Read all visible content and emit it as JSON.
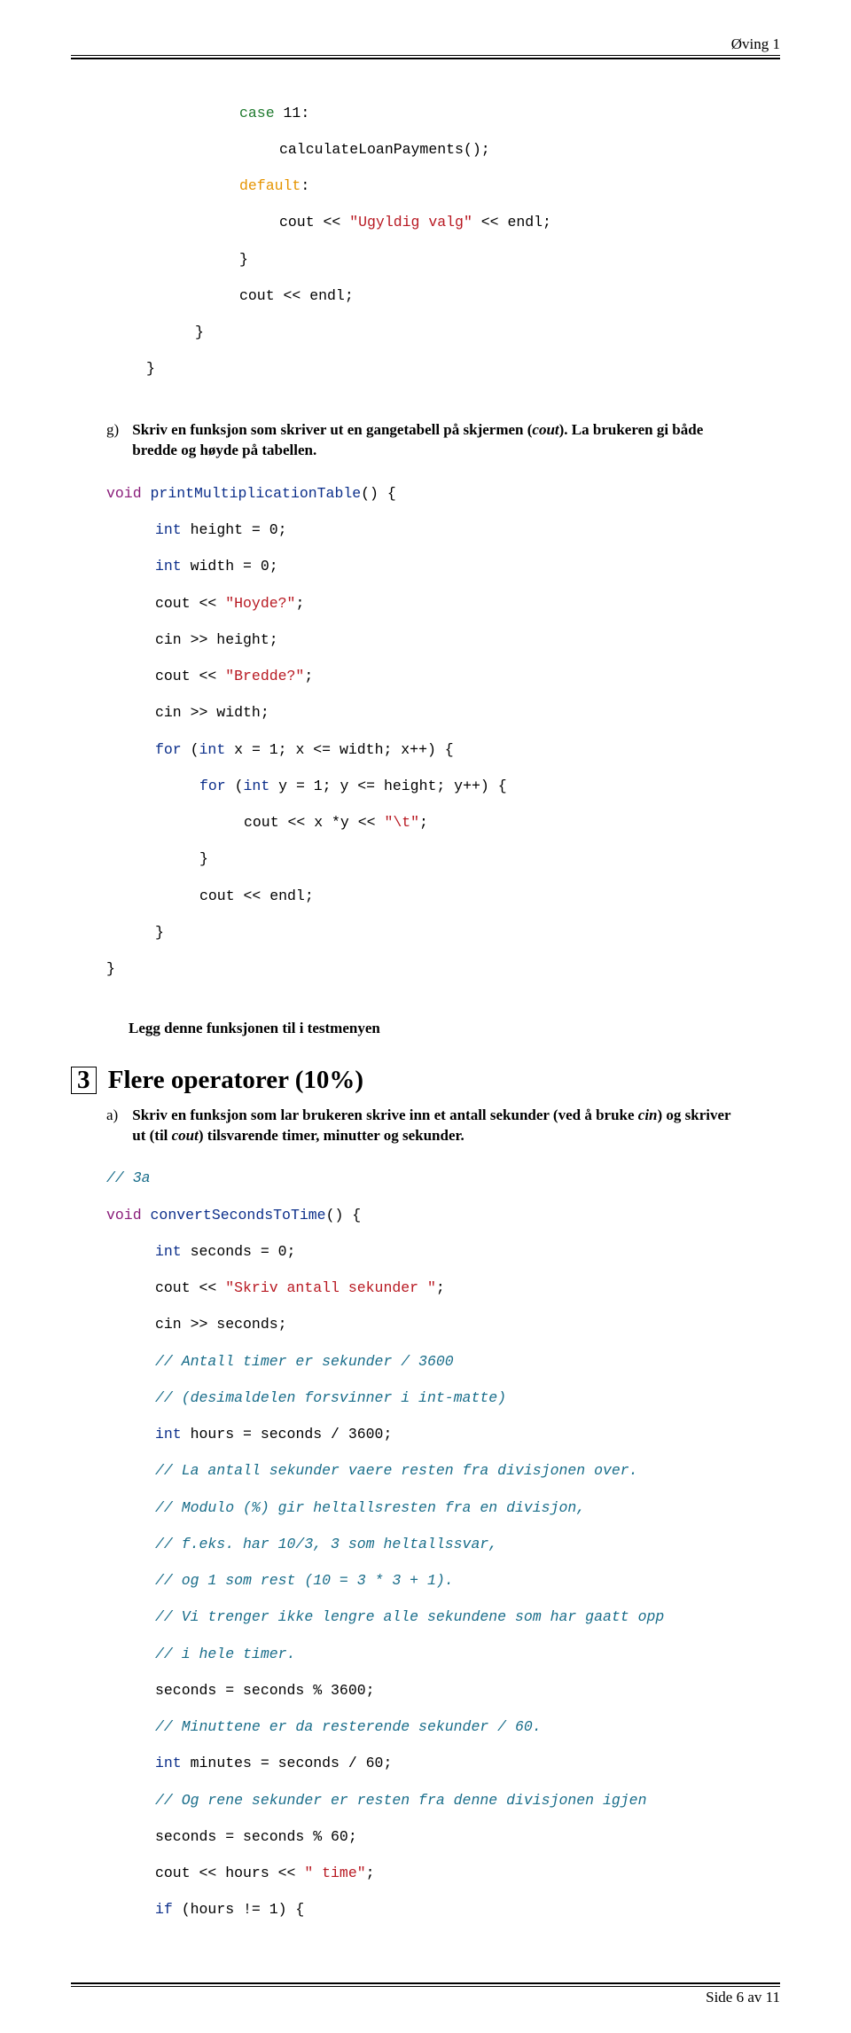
{
  "header": {
    "title": "Øving 1"
  },
  "code1": {
    "l1a": "case",
    "l1b": " 11:",
    "l2": "calculateLoanPayments();",
    "l3a": "default",
    "l3b": ":",
    "l4a": "cout << ",
    "l4b": "\"Ugyldig valg\"",
    "l4c": " << endl;",
    "l5": "}",
    "l6": "cout << endl;",
    "l7": "}",
    "l8": "}"
  },
  "item_g": {
    "label": "g)",
    "text1": "Skriv en funksjon som skriver ut en gangetabell på skjermen (",
    "em1": "cout",
    "text2": "). La brukeren gi både bredde og høyde på tabellen."
  },
  "code2": {
    "l1a": "void",
    "l1b": " ",
    "l1c": "printMultiplicationTable",
    "l1d": "() {",
    "l2a": "int",
    "l2b": " height = 0;",
    "l3a": "int",
    "l3b": " width = 0;",
    "l4a": "cout << ",
    "l4b": "\"Hoyde?\"",
    "l4c": ";",
    "l5": "cin >> height;",
    "l6a": "cout << ",
    "l6b": "\"Bredde?\"",
    "l6c": ";",
    "l7": "cin >> width;",
    "l8a": "for",
    "l8b": " (",
    "l8c": "int",
    "l8d": " x = 1; x <= width; x++) {",
    "l9a": "for",
    "l9b": " (",
    "l9c": "int",
    "l9d": " y = 1; y <= height; y++) {",
    "l10a": "cout << x *y << ",
    "l10b": "\"\\t\"",
    "l10c": ";",
    "l11": "}",
    "l12": "cout << endl;",
    "l13": "}",
    "l14": "}"
  },
  "post2": "Legg denne funksjonen til i testmenyen",
  "section": {
    "num": "3",
    "title": "Flere operatorer (10%)"
  },
  "item_a": {
    "label": "a)",
    "text1": "Skriv en funksjon som lar brukeren skrive inn et antall sekunder (ved å bruke ",
    "em1": "cin",
    "text2": ") og skriver ut (til ",
    "em2": "cout",
    "text3": ") tilsvarende timer, minutter og sekunder."
  },
  "code3": {
    "l1": "// 3a",
    "l2a": "void",
    "l2b": " ",
    "l2c": "convertSecondsToTime",
    "l2d": "() {",
    "l3a": "int",
    "l3b": " seconds = 0;",
    "l4a": "cout << ",
    "l4b": "\"Skriv antall sekunder \"",
    "l4c": ";",
    "l5": "cin >> seconds;",
    "l6": "// Antall timer er sekunder / 3600",
    "l7": "// (desimaldelen forsvinner i int-matte)",
    "l8a": "int",
    "l8b": " hours = seconds / 3600;",
    "l9": "// La antall sekunder vaere resten fra divisjonen over.",
    "l10": "// Modulo (%) gir heltallsresten fra en divisjon,",
    "l11": "// f.eks. har 10/3, 3 som heltallssvar,",
    "l12": "// og 1 som rest (10 = 3 * 3 + 1).",
    "l13": "// Vi trenger ikke lengre alle sekundene som har gaatt opp",
    "l14": "// i hele timer.",
    "l15": "seconds = seconds % 3600;",
    "l16": "// Minuttene er da resterende sekunder / 60.",
    "l17a": "int",
    "l17b": " minutes = seconds / 60;",
    "l18": "// Og rene sekunder er resten fra denne divisjonen igjen",
    "l19": "seconds = seconds % 60;",
    "l20a": "cout << hours << ",
    "l20b": "\" time\"",
    "l20c": ";",
    "l21a": "if",
    "l21b": " (hours != 1) {"
  },
  "footer": {
    "text": "Side 6 av 11"
  }
}
